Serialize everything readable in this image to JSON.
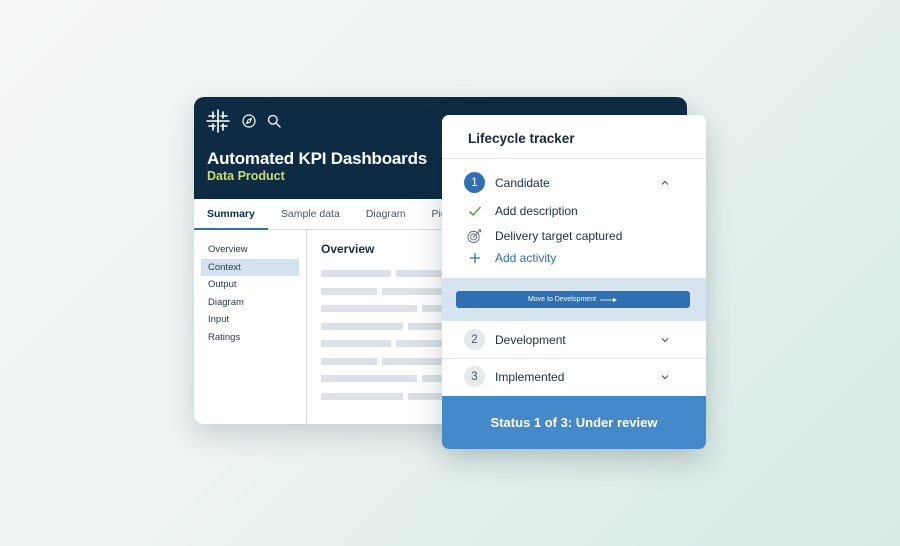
{
  "app": {
    "title": "Automated KPI Dashboards",
    "subtitle": "Data Product",
    "icons": [
      "logo-icon",
      "compass-icon",
      "search-icon"
    ],
    "tabs": [
      {
        "label": "Summary",
        "active": true
      },
      {
        "label": "Sample data",
        "active": false
      },
      {
        "label": "Diagram",
        "active": false
      },
      {
        "label": "Pio",
        "active": false
      }
    ],
    "side_nav": [
      {
        "label": "Overview",
        "active": false
      },
      {
        "label": "Context",
        "active": true
      },
      {
        "label": "Output",
        "active": false
      },
      {
        "label": "Diagram",
        "active": false
      },
      {
        "label": "Input",
        "active": false
      },
      {
        "label": "Ratings",
        "active": false
      }
    ],
    "overview_heading": "Overview"
  },
  "tracker": {
    "title": "Lifecycle tracker",
    "steps": [
      {
        "number": "1",
        "label": "Candidate",
        "expanded": true
      },
      {
        "number": "2",
        "label": "Development",
        "expanded": false
      },
      {
        "number": "3",
        "label": "Implemented",
        "expanded": false
      }
    ],
    "sub_items": [
      {
        "icon": "check-icon",
        "label": "Add description"
      },
      {
        "icon": "target-icon",
        "label": "Delivery target captured"
      },
      {
        "icon": "plus-icon",
        "label": "Add activity"
      }
    ],
    "move_button_label": "Move to Development",
    "status": "Status 1 of 3: Under review"
  },
  "colors": {
    "header_bg": "#0d2c44",
    "subtitle_accent": "#c9dd6b",
    "primary_blue": "#2f6fb3",
    "status_blue": "#4489c9",
    "check_green": "#5aa83a"
  }
}
